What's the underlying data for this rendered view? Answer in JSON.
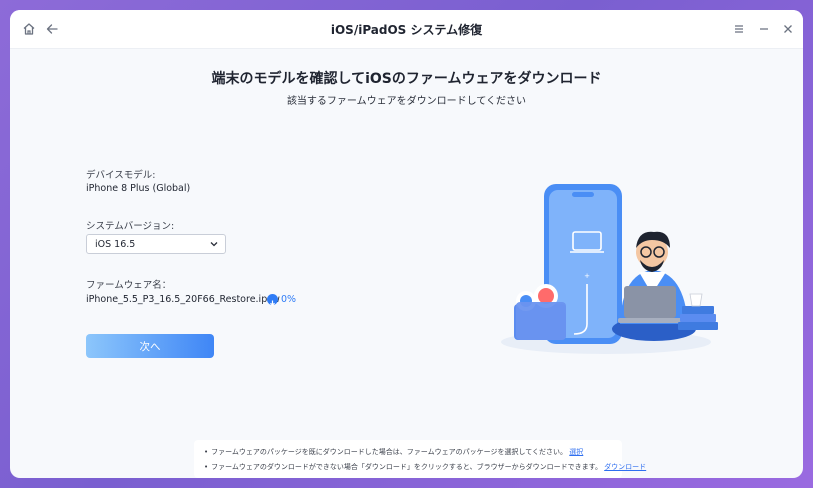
{
  "window": {
    "title": "iOS/iPadOS システム修復"
  },
  "header": {
    "heading": "端末のモデルを確認してiOSのファームウェアをダウンロード",
    "subheading": "該当するファームウェアをダウンロードしてください"
  },
  "device": {
    "label": "デバイスモデル:",
    "value": "iPhone 8 Plus (Global)"
  },
  "system_version": {
    "label": "システムバージョン:",
    "selected": "iOS 16.5"
  },
  "firmware": {
    "label": "ファームウェア名：",
    "filename": "iPhone_5.5_P3_16.5_20F66_Restore.ipsw",
    "progress_text": "0%",
    "progress": 0
  },
  "actions": {
    "next_label": "次へ"
  },
  "notes": {
    "note1_text": "ファームウェアのパッケージを既にダウンロードした場合は、ファームウェアのパッケージを選択してください。",
    "note1_link": "選択",
    "note2_text": "ファームウェアのダウンロードができない場合「ダウンロード」をクリックすると、ブラウザーからダウンロードできます。",
    "note2_link": "ダウンロード"
  },
  "icons": {
    "home": "home-icon",
    "back": "back-arrow-icon",
    "menu": "menu-icon",
    "minimize": "minimize-icon",
    "close": "close-icon",
    "dropdown": "chevron-down-icon",
    "download": "download-icon"
  },
  "colors": {
    "accent": "#2f7cf6",
    "button_start": "#8cc6fb",
    "button_end": "#3f86f6",
    "link": "#2f6ff0"
  }
}
